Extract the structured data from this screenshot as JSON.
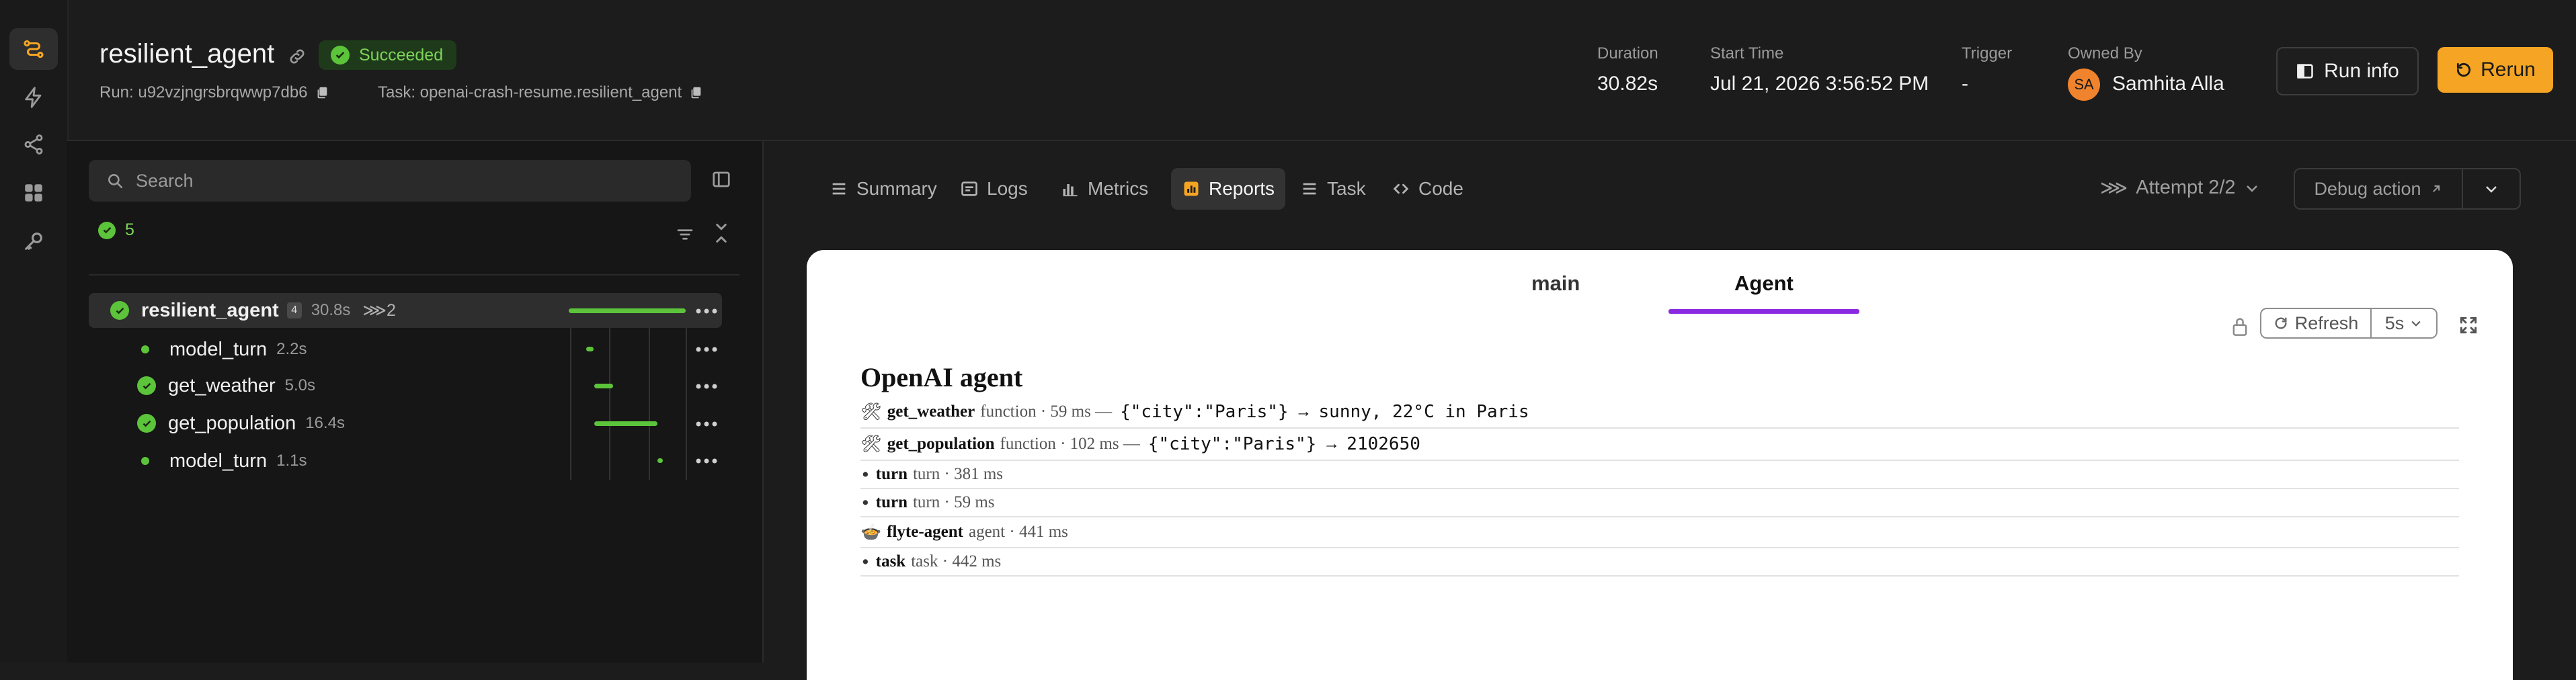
{
  "header": {
    "title": "resilient_agent",
    "status": "Succeeded",
    "run_label": "Run: u92vzjngrsbrqwwp7db6",
    "task_label": "Task: openai-crash-resume.resilient_agent",
    "meta": [
      {
        "label": "Duration",
        "value": "30.82s"
      },
      {
        "label": "Start Time",
        "value": "Jul 21, 2026 3:56:52 PM"
      },
      {
        "label": "Trigger",
        "value": "-"
      },
      {
        "label": "Owned By",
        "value": "Samhita Alla"
      }
    ],
    "avatar_initials": "SA",
    "run_info_label": "Run info",
    "rerun_label": "Rerun"
  },
  "sidebar": {
    "search_placeholder": "Search",
    "success_count": "5",
    "rows": [
      {
        "name": "resilient_agent",
        "duration": "30.8s",
        "tag": "4",
        "attempts": "2",
        "bar_start": 0.0,
        "bar_end": 1.0
      },
      {
        "name": "model_turn",
        "duration": "2.2s",
        "bar_start": 0.15,
        "bar_end": 0.21
      },
      {
        "name": "get_weather",
        "duration": "5.0s",
        "bar_start": 0.22,
        "bar_end": 0.38
      },
      {
        "name": "get_population",
        "duration": "16.4s",
        "bar_start": 0.22,
        "bar_end": 0.76
      },
      {
        "name": "model_turn",
        "duration": "1.1s",
        "bar_start": 0.76,
        "bar_end": 0.8
      }
    ]
  },
  "tabs": [
    "Summary",
    "Logs",
    "Metrics",
    "Reports",
    "Task",
    "Code"
  ],
  "active_tab": "Reports",
  "attempt_label": "Attempt 2/2",
  "debug_label": "Debug action",
  "report": {
    "tabs": [
      "main",
      "Agent"
    ],
    "active": "Agent",
    "refresh_label": "Refresh",
    "interval": "5s",
    "title": "OpenAI agent",
    "lines": [
      {
        "glyph": "🛠",
        "name": "get_weather",
        "meta": "function · 59 ms —",
        "input": "{\"city\":\"Paris\"}",
        "arrow": "→",
        "output": "sunny, 22°C in Paris"
      },
      {
        "glyph": "🛠",
        "name": "get_population",
        "meta": "function · 102 ms —",
        "input": "{\"city\":\"Paris\"}",
        "arrow": "→",
        "output": "2102650"
      },
      {
        "glyph": "•",
        "name": "turn",
        "meta": "turn · 381 ms"
      },
      {
        "glyph": "•",
        "name": "turn",
        "meta": "turn · 59 ms"
      },
      {
        "glyph": "🍲",
        "name": "flyte-agent",
        "meta": "agent · 441 ms"
      },
      {
        "glyph": "•",
        "name": "task",
        "meta": "task · 442 ms"
      }
    ]
  },
  "colors": {
    "accent": "#f5a523",
    "success": "#5cc43a",
    "purple": "#8a2be2"
  }
}
